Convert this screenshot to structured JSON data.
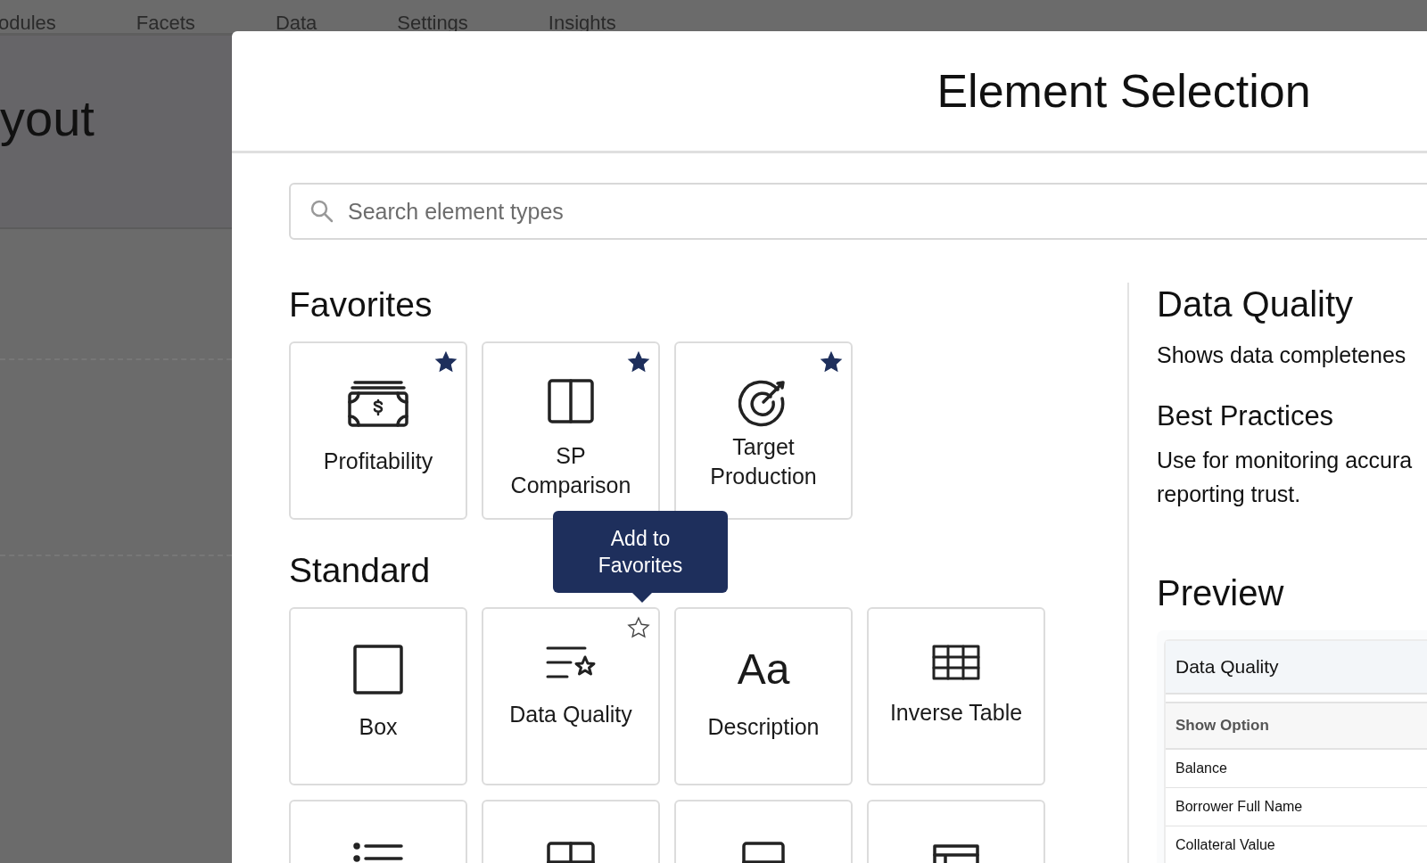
{
  "background": {
    "nav": [
      "odules",
      "Facets",
      "Data",
      "Settings",
      "Insights"
    ],
    "page_title": "yout"
  },
  "modal": {
    "title": "Element Selection",
    "search": {
      "placeholder": "Search element types"
    },
    "sections": [
      {
        "heading": "Favorites",
        "cards": [
          {
            "label": "Profitability",
            "favorite": true
          },
          {
            "label": "SP Comparison",
            "favorite": true
          },
          {
            "label": "Target Production",
            "favorite": true
          }
        ]
      },
      {
        "heading": "Standard",
        "cards": [
          {
            "label": "Box"
          },
          {
            "label": "Data Quality",
            "favorite": false,
            "tooltip": "Add to Favorites"
          },
          {
            "label": "Description",
            "icon_text": "Aa"
          },
          {
            "label": "Inverse Table"
          },
          {
            "kind": "partial"
          },
          {
            "kind": "partial"
          },
          {
            "kind": "partial"
          },
          {
            "kind": "partial"
          }
        ]
      }
    ],
    "details": {
      "title": "Data Quality",
      "description": "Shows data completenes",
      "best_practices_heading": "Best Practices",
      "best_practices": [
        "Use for monitoring accura",
        "reporting trust."
      ],
      "preview_heading": "Preview",
      "preview": {
        "title": "Data Quality",
        "column": "Show Option",
        "rows": [
          "Balance",
          "Borrower Full Name",
          "Collateral Value"
        ]
      }
    }
  }
}
